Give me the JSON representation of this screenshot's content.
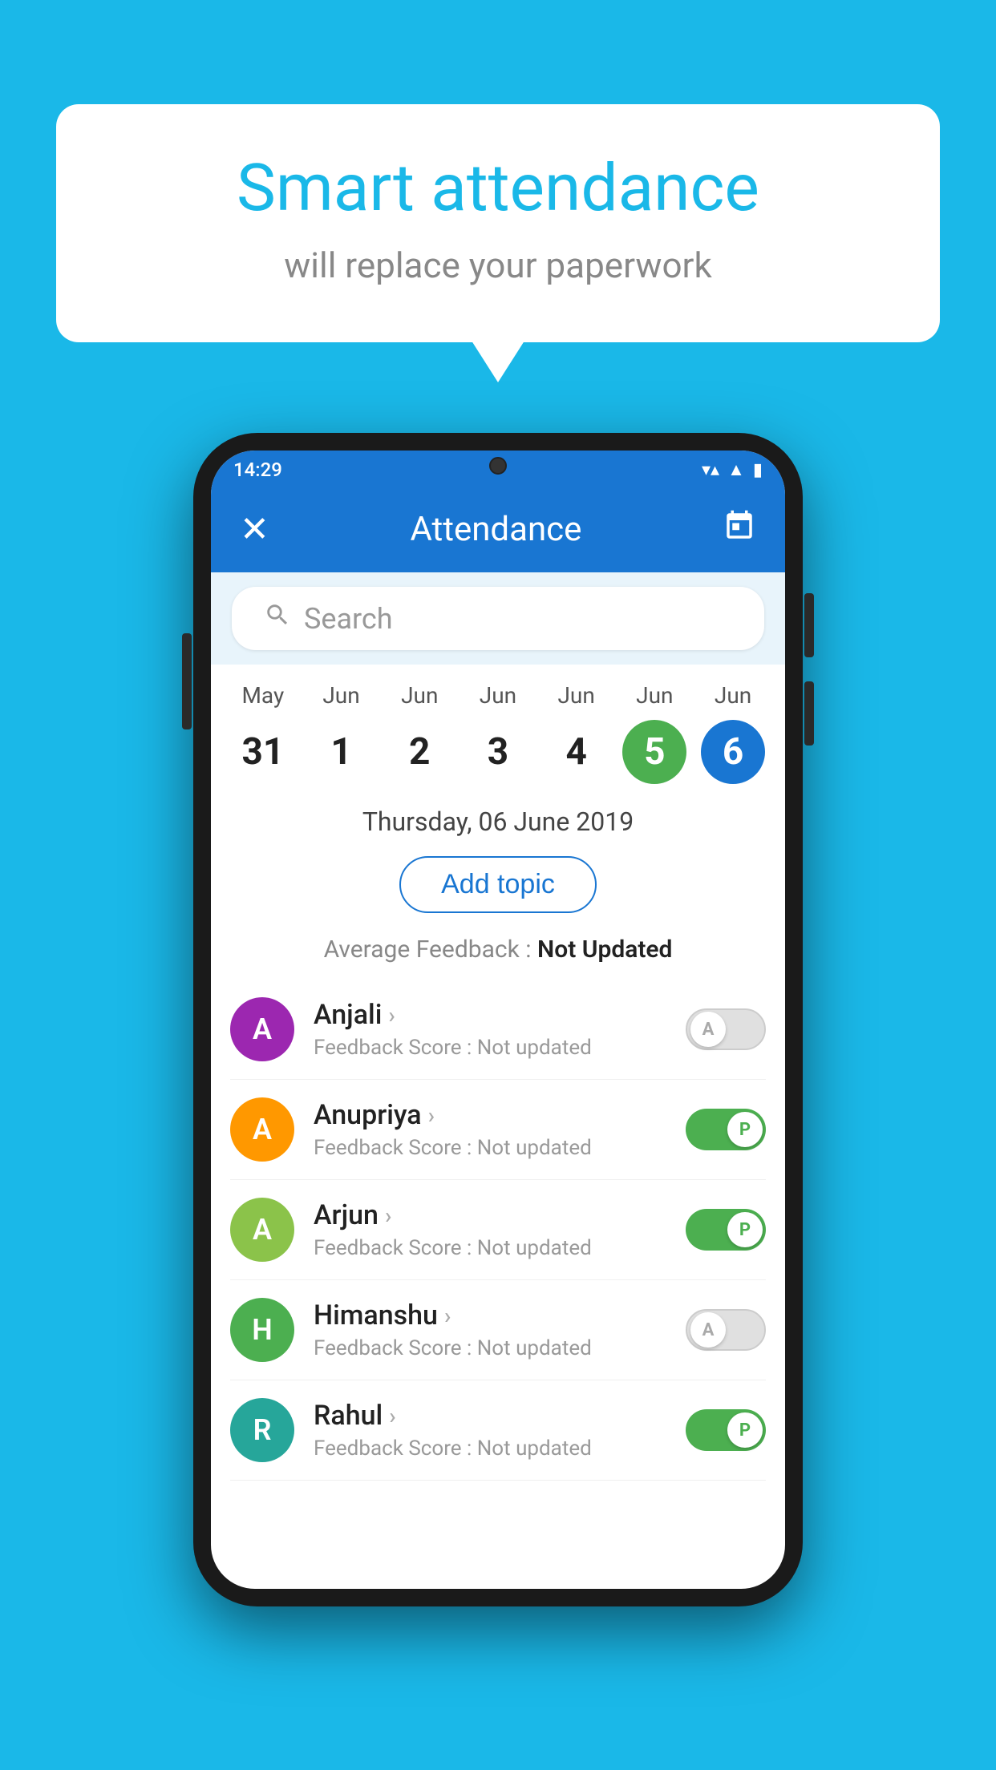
{
  "background_color": "#1ab8e8",
  "speech_bubble": {
    "title": "Smart attendance",
    "subtitle": "will replace your paperwork"
  },
  "phone": {
    "status_bar": {
      "time": "14:29",
      "icons": [
        "wifi",
        "signal",
        "battery"
      ]
    },
    "header": {
      "close_label": "✕",
      "title": "Attendance",
      "calendar_icon": "📅"
    },
    "search": {
      "placeholder": "Search"
    },
    "calendar": {
      "days": [
        {
          "month": "May",
          "date": "31",
          "style": "normal"
        },
        {
          "month": "Jun",
          "date": "1",
          "style": "normal"
        },
        {
          "month": "Jun",
          "date": "2",
          "style": "normal"
        },
        {
          "month": "Jun",
          "date": "3",
          "style": "normal"
        },
        {
          "month": "Jun",
          "date": "4",
          "style": "normal"
        },
        {
          "month": "Jun",
          "date": "5",
          "style": "today"
        },
        {
          "month": "Jun",
          "date": "6",
          "style": "selected"
        }
      ]
    },
    "selected_date": "Thursday, 06 June 2019",
    "add_topic_label": "Add topic",
    "average_feedback": {
      "label": "Average Feedback :",
      "value": "Not Updated"
    },
    "students": [
      {
        "name": "Anjali",
        "avatar_letter": "A",
        "avatar_color": "purple",
        "feedback": "Feedback Score : Not updated",
        "toggle_state": "off",
        "toggle_label": "A"
      },
      {
        "name": "Anupriya",
        "avatar_letter": "A",
        "avatar_color": "orange",
        "feedback": "Feedback Score : Not updated",
        "toggle_state": "on",
        "toggle_label": "P"
      },
      {
        "name": "Arjun",
        "avatar_letter": "A",
        "avatar_color": "green-light",
        "feedback": "Feedback Score : Not updated",
        "toggle_state": "on",
        "toggle_label": "P"
      },
      {
        "name": "Himanshu",
        "avatar_letter": "H",
        "avatar_color": "green-dark",
        "feedback": "Feedback Score : Not updated",
        "toggle_state": "off",
        "toggle_label": "A"
      },
      {
        "name": "Rahul",
        "avatar_letter": "R",
        "avatar_color": "teal",
        "feedback": "Feedback Score : Not updated",
        "toggle_state": "on",
        "toggle_label": "P"
      }
    ]
  }
}
